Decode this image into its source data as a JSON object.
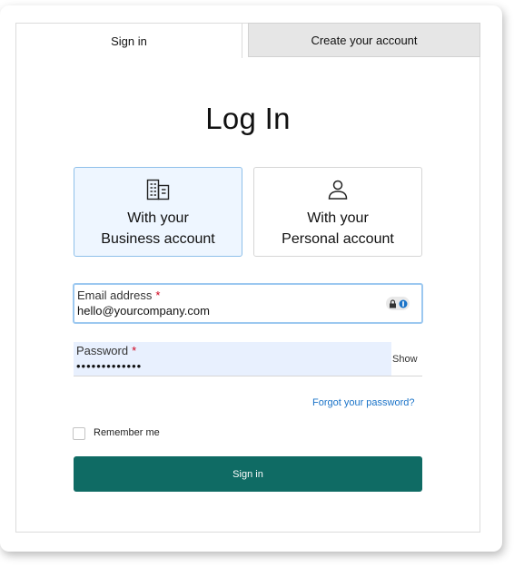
{
  "tabs": {
    "signin": "Sign in",
    "create": "Create your account"
  },
  "title": "Log In",
  "account_types": {
    "business": {
      "line1": "With your",
      "line2": "Business account",
      "icon": "building-icon",
      "selected": true
    },
    "personal": {
      "line1": "With your",
      "line2": "Personal account",
      "icon": "person-icon",
      "selected": false
    }
  },
  "email": {
    "label": "Email address",
    "required_mark": "*",
    "value": "hello@yourcompany.com"
  },
  "password": {
    "label": "Password",
    "required_mark": "*",
    "value": "•••••••••••••",
    "show_label": "Show"
  },
  "forgot_link": "Forgot your password?",
  "remember_me": {
    "label": "Remember me",
    "checked": false
  },
  "signin_button": "Sign in",
  "colors": {
    "accent": "#0f6b64",
    "link": "#1a73c8",
    "selected_bg": "#eef6ff",
    "selected_border": "#8fc0ea",
    "autofill_bg": "#e8f0fe",
    "required": "#d0021b"
  }
}
